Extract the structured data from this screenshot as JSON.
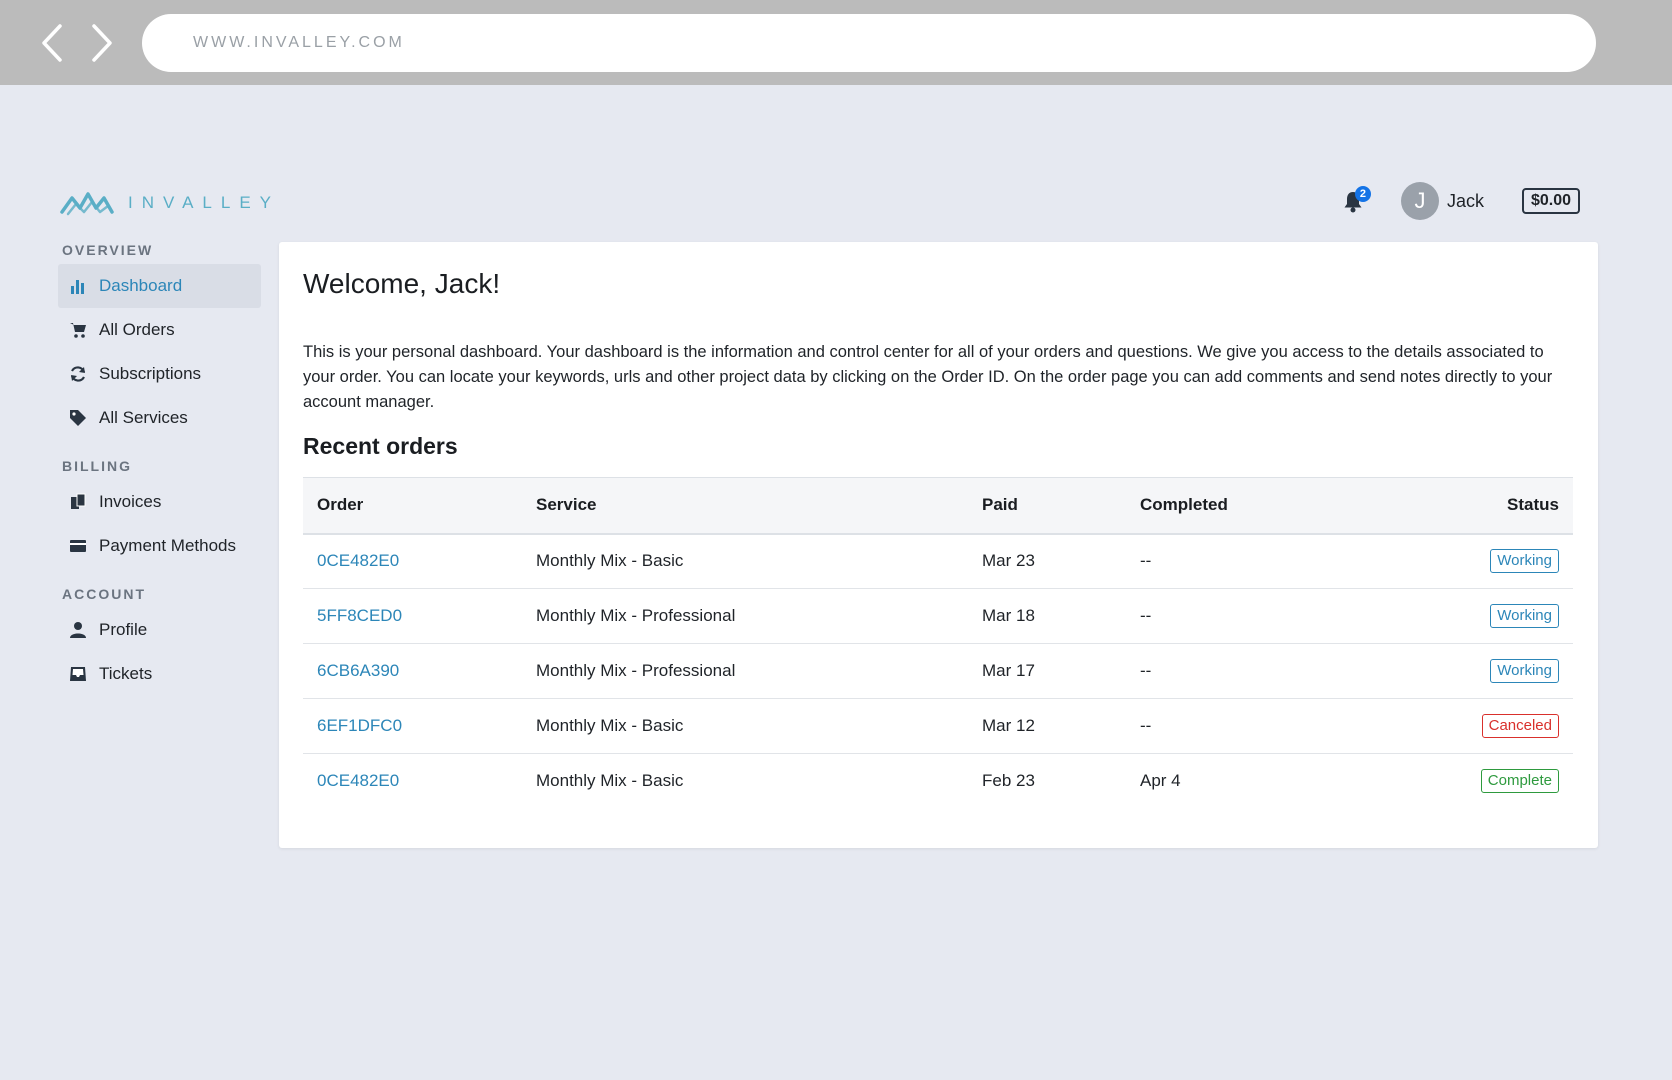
{
  "browser": {
    "url": "WWW.INVALLEY.COM"
  },
  "brand": {
    "name": "INVALLEY",
    "accent": "#5aaec6"
  },
  "header": {
    "notifications_count": "2",
    "user_initial": "J",
    "user_name": "Jack",
    "balance": "$0.00"
  },
  "sidebar": {
    "overview_label": "OVERVIEW",
    "billing_label": "BILLING",
    "account_label": "ACCOUNT",
    "overview_items": [
      {
        "label": "Dashboard",
        "icon": "bar-chart-icon"
      },
      {
        "label": "All Orders",
        "icon": "cart-icon"
      },
      {
        "label": "Subscriptions",
        "icon": "refresh-icon"
      },
      {
        "label": "All Services",
        "icon": "tag-icon"
      }
    ],
    "billing_items": [
      {
        "label": "Invoices",
        "icon": "documents-icon"
      },
      {
        "label": "Payment Methods",
        "icon": "credit-card-icon"
      }
    ],
    "account_items": [
      {
        "label": "Profile",
        "icon": "user-icon"
      },
      {
        "label": "Tickets",
        "icon": "inbox-icon"
      }
    ],
    "active": "Dashboard"
  },
  "main": {
    "welcome": "Welcome, Jack!",
    "intro": "This is your personal dashboard. Your dashboard is the information and control center for all of your orders and questions. We give you access to the details associated to your order. You can locate your keywords, urls and other project data by clicking on the Order ID. On the order page you can add comments and send notes directly to your account manager.",
    "recent_title": "Recent orders",
    "table": {
      "headers": [
        "Order",
        "Service",
        "Paid",
        "Completed",
        "Status"
      ],
      "rows": [
        {
          "order": "0CE482E0",
          "service": "Monthly Mix - Basic",
          "paid": "Mar 23",
          "completed": "--",
          "status": "Working"
        },
        {
          "order": "5FF8CED0",
          "service": "Monthly Mix - Professional",
          "paid": "Mar 18",
          "completed": "--",
          "status": "Working"
        },
        {
          "order": "6CB6A390",
          "service": "Monthly Mix - Professional",
          "paid": "Mar 17",
          "completed": "--",
          "status": "Working"
        },
        {
          "order": "6EF1DFC0",
          "service": "Monthly Mix - Basic",
          "paid": "Mar 12",
          "completed": "--",
          "status": "Canceled"
        },
        {
          "order": "0CE482E0",
          "service": "Monthly Mix - Basic",
          "paid": "Feb 23",
          "completed": "Apr 4",
          "status": "Complete"
        }
      ]
    }
  },
  "colors": {
    "link": "#2c86b8",
    "working": "#2c86b8",
    "canceled": "#d9302c",
    "complete": "#2e9a3e"
  }
}
